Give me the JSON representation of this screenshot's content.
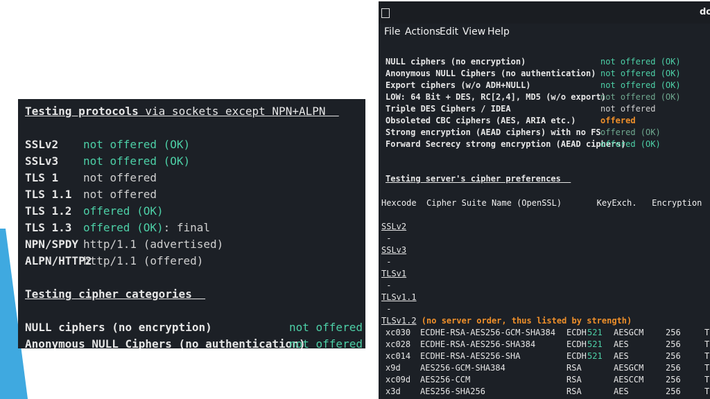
{
  "left": {
    "heading_bold": "Testing protocols",
    "heading_rest": " via sockets except NPN+ALPN",
    "protocols": [
      {
        "name": "SSLv2",
        "status": "not offered (OK)",
        "extra": ""
      },
      {
        "name": "SSLv3",
        "status": "not offered (OK)",
        "extra": ""
      },
      {
        "name": "TLS 1",
        "status": "not offered",
        "extra": ""
      },
      {
        "name": "TLS 1.1",
        "status": "not offered",
        "extra": ""
      },
      {
        "name": "TLS 1.2",
        "status": "offered (OK)",
        "extra": ""
      },
      {
        "name": "TLS 1.3",
        "status": "offered (OK)",
        "extra": ": final"
      },
      {
        "name": "NPN/SPDY",
        "status": "http/1.1 (advertised)",
        "extra": ""
      },
      {
        "name": "ALPN/HTTP2",
        "status": "http/1.1 (offered)",
        "extra": ""
      }
    ],
    "cipher_heading": "Testing cipher categories",
    "cipher_rows": [
      {
        "name": "NULL ciphers (no encryption)",
        "status": "not offered (OK"
      },
      {
        "name": "Anonymous NULL Ciphers (no authentication)",
        "status": "not offered (OK"
      }
    ]
  },
  "right": {
    "title_fragment": "do",
    "menu": [
      "File",
      "Actions",
      "Edit",
      "View",
      "Help"
    ],
    "categories": [
      {
        "name": "NULL ciphers (no encryption)",
        "status": "not offered (OK)"
      },
      {
        "name": "Anonymous NULL Ciphers (no authentication)",
        "status": "not offered (OK)"
      },
      {
        "name": "Export ciphers (w/o ADH+NULL)",
        "status": "not offered (OK)"
      },
      {
        "name": "LOW: 64 Bit + DES, RC[2,4], MD5 (w/o export)",
        "status": "not offered (OK)"
      },
      {
        "name": "Triple DES Ciphers / IDEA",
        "status": "not offered"
      },
      {
        "name": "Obsoleted CBC ciphers (AES, ARIA etc.)",
        "status": "offered"
      },
      {
        "name": "Strong encryption (AEAD ciphers) with no FS",
        "status": "offered (OK)"
      },
      {
        "name": "Forward Secrecy strong encryption (AEAD ciphers)",
        "status": "offered (OK)"
      }
    ],
    "pref_heading": "Testing server's cipher preferences",
    "table_header": "Hexcode  Cipher Suite Name (OpenSSL)       KeyExch.   Encryption  Bits     Ci",
    "protocols": [
      {
        "name": "SSLv2",
        "dash": " -"
      },
      {
        "name": "SSLv3",
        "dash": " -"
      },
      {
        "name": "TLSv1",
        "dash": " -"
      },
      {
        "name": "TLSv1.1",
        "dash": " -"
      }
    ],
    "tls12_label": "TLSv1.2",
    "tls12_note": " (no server order, thus listed by strength)",
    "ciphers": [
      {
        "hex": "xc030",
        "name": "ECDHE-RSA-AES256-GCM-SHA384",
        "kx": "ECDH",
        "kxbits": "521",
        "enc": "AESGCM",
        "bits": "256",
        "tail": "T"
      },
      {
        "hex": "xc028",
        "name": "ECDHE-RSA-AES256-SHA384",
        "kx": "ECDH",
        "kxbits": "521",
        "enc": "AES",
        "bits": "256",
        "tail": "T"
      },
      {
        "hex": "xc014",
        "name": "ECDHE-RSA-AES256-SHA",
        "kx": "ECDH",
        "kxbits": "521",
        "enc": "AES",
        "bits": "256",
        "tail": "T"
      },
      {
        "hex": "x9d",
        "name": "AES256-GCM-SHA384",
        "kx": "RSA",
        "kxbits": "",
        "enc": "AESGCM",
        "bits": "256",
        "tail": "T"
      },
      {
        "hex": "xc09d",
        "name": "AES256-CCM",
        "kx": "RSA",
        "kxbits": "",
        "enc": "AESCCM",
        "bits": "256",
        "tail": "T"
      },
      {
        "hex": "x3d",
        "name": "AES256-SHA256",
        "kx": "RSA",
        "kxbits": "",
        "enc": "AES",
        "bits": "256",
        "tail": "T"
      }
    ]
  },
  "colors": {
    "terminal_bg": "#1c2026",
    "ok_green": "#4dd0a7",
    "warn_orange": "#f0902a",
    "accent_blue": "#3fa9e0"
  }
}
